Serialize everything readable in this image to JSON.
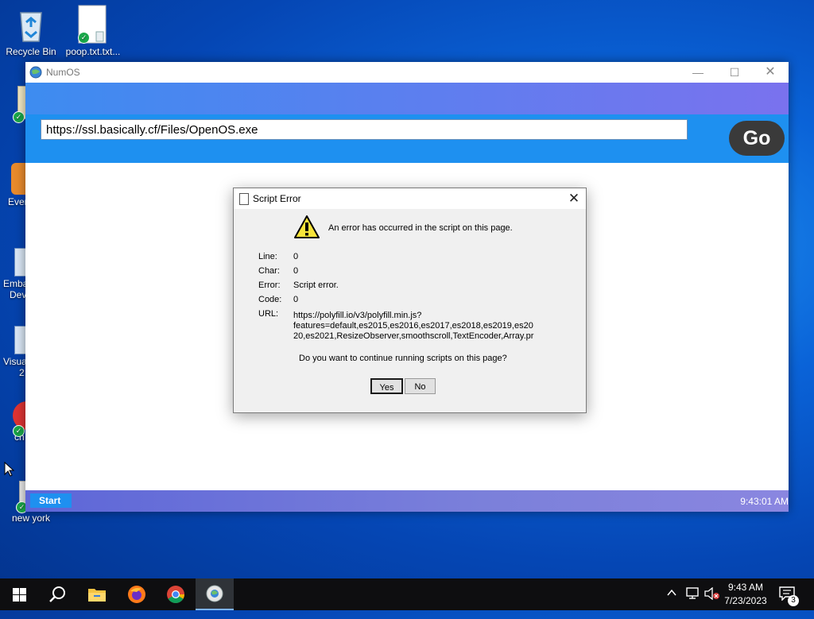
{
  "desktop": {
    "icons": [
      {
        "label": "Recycle Bin",
        "icon": "recycle-bin-icon"
      },
      {
        "label": "poop.txt.txt...",
        "icon": "text-file-icon"
      },
      {
        "label": "Ever",
        "icon": "shortcut-icon"
      },
      {
        "label": "Emba",
        "label2": "Dev",
        "icon": "app-icon"
      },
      {
        "label": "Visua",
        "label2": "2",
        "icon": "app-icon"
      },
      {
        "label": "ch",
        "icon": "chrome-icon"
      },
      {
        "label": "new york",
        "icon": "image-file-icon"
      }
    ]
  },
  "window": {
    "title": "NumOS",
    "url": "https://ssl.basically.cf/Files/OpenOS.exe",
    "go_label": "Go",
    "start_label": "Start",
    "clock": "9:43:01 AM"
  },
  "dialog": {
    "title": "Script Error",
    "message": "An error has occurred in the script on this page.",
    "fields": {
      "line_label": "Line:",
      "line_value": "0",
      "char_label": "Char:",
      "char_value": "0",
      "error_label": "Error:",
      "error_value": "Script error.",
      "code_label": "Code:",
      "code_value": "0",
      "url_label": "URL:",
      "url_line1": "https://polyfill.io/v3/polyfill.min.js?",
      "url_line2": "features=default,es2015,es2016,es2017,es2018,es2019,es20",
      "url_line3": "20,es2021,ResizeObserver,smoothscroll,TextEncoder,Array.pr"
    },
    "question": "Do you want to continue running scripts on this page?",
    "yes_label": "Yes",
    "no_label": "No"
  },
  "taskbar": {
    "time": "9:43 AM",
    "date": "7/23/2023",
    "notification_count": "3"
  }
}
